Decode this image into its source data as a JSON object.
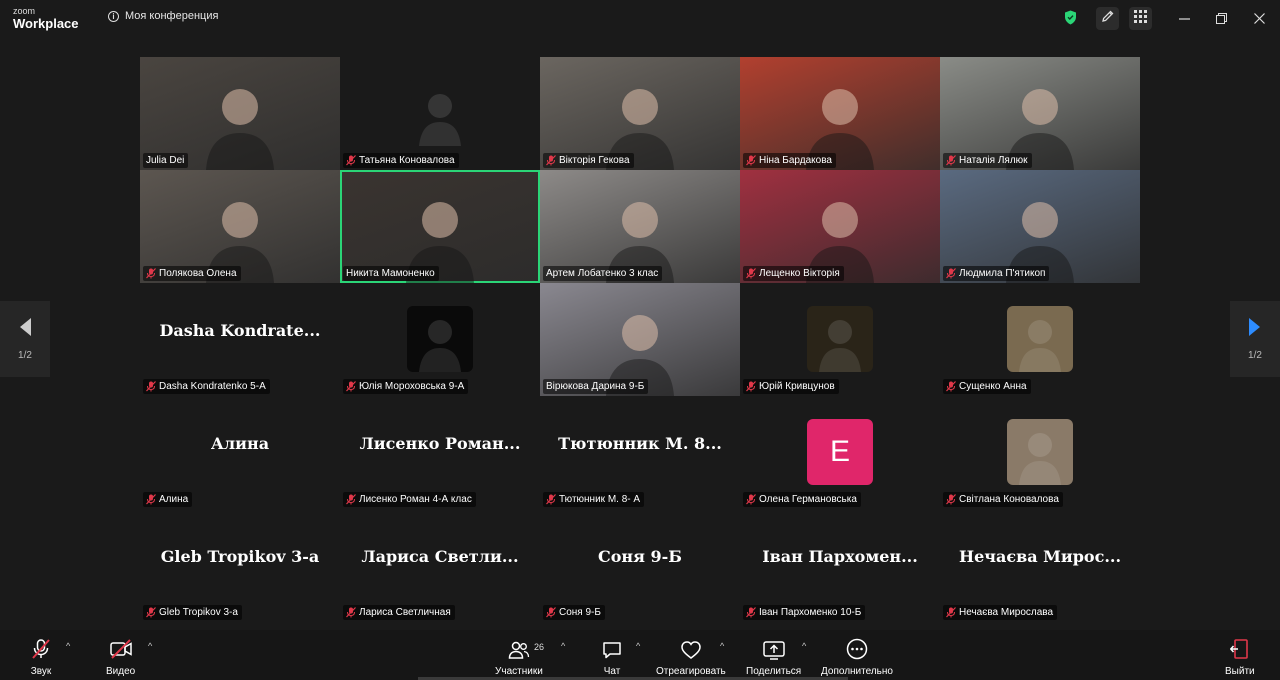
{
  "app": {
    "brand_small": "zoom",
    "brand_big": "Workplace"
  },
  "meeting": {
    "title": "Моя конференция"
  },
  "pager": {
    "left_page": "1/2",
    "right_page": "1/2"
  },
  "participants": [
    {
      "name": "Julia Dei",
      "muted": false,
      "kind": "video",
      "bg": "#4a4540"
    },
    {
      "name": "Татьяна Коновалова",
      "muted": true,
      "kind": "avatar",
      "bg": "#1a1a1a"
    },
    {
      "name": "Вікторія Гекова",
      "muted": true,
      "kind": "video",
      "bg": "#6b6660"
    },
    {
      "name": "Ніна Бардакова",
      "muted": true,
      "kind": "video",
      "bg": "#b2402f"
    },
    {
      "name": "Наталія Лялюк",
      "muted": true,
      "kind": "video",
      "bg": "#8a8c87"
    },
    {
      "name": "Полякова Олена",
      "muted": true,
      "kind": "video",
      "bg": "#5c5650"
    },
    {
      "name": "Никита Мамоненко",
      "muted": false,
      "kind": "video",
      "bg": "#3a3430",
      "active": true
    },
    {
      "name": "Артем Лобатенко 3 клас",
      "muted": false,
      "kind": "video",
      "bg": "#8d8a88"
    },
    {
      "name": "Лещенко Вікторія",
      "muted": true,
      "kind": "video",
      "bg": "#a03040"
    },
    {
      "name": "Людмила П'ятикоп",
      "muted": true,
      "kind": "video",
      "bg": "#5a6a80"
    },
    {
      "name": "Dasha Kondratenko 5-A",
      "display": "Dasha  Kondrate...",
      "muted": true,
      "kind": "text"
    },
    {
      "name": "Юлія Мороховська 9-А",
      "muted": true,
      "kind": "avatar",
      "bg": "#0a0a0a"
    },
    {
      "name": "Вірюкова Дарина 9-Б",
      "muted": false,
      "kind": "video",
      "bg": "#8a8890"
    },
    {
      "name": "Юрій Кривцунов",
      "muted": true,
      "kind": "avatar",
      "bg": "#2a2418"
    },
    {
      "name": "Сущенко Анна",
      "muted": true,
      "kind": "avatar",
      "bg": "#7a6a50"
    },
    {
      "name": "Алина",
      "display": "Алина",
      "muted": true,
      "kind": "text"
    },
    {
      "name": "Лисенко Роман 4-А клас",
      "display": "Лисенко  Роман...",
      "muted": true,
      "kind": "text"
    },
    {
      "name": "Тютюнник М. 8- А",
      "display": "Тютюнник  М.  8...",
      "muted": true,
      "kind": "text"
    },
    {
      "name": "Олена Германовська",
      "muted": true,
      "kind": "letter",
      "letter": "E",
      "bg": "#e0266a"
    },
    {
      "name": "Світлана Коновалова",
      "muted": true,
      "kind": "avatar",
      "bg": "#8a7a68"
    },
    {
      "name": "Gleb Tropikov 3-a",
      "display": "Gleb Tropikov 3-a",
      "muted": true,
      "kind": "text"
    },
    {
      "name": "Лариса Светличная",
      "display": "Лариса  Светли...",
      "muted": true,
      "kind": "text"
    },
    {
      "name": "Соня 9-Б",
      "display": "Соня 9-Б",
      "muted": true,
      "kind": "text"
    },
    {
      "name": "Іван Пархоменко 10-Б",
      "display": "Іван  Пархомен...",
      "muted": true,
      "kind": "text"
    },
    {
      "name": "Нечаєва Мирослава",
      "display": "Нечаєва  Мирос...",
      "muted": true,
      "kind": "text"
    }
  ],
  "toolbar": {
    "audio": "Звук",
    "video": "Видео",
    "participants": "Участники",
    "participants_count": "26",
    "chat": "Чат",
    "react": "Отреагировать",
    "share": "Поделиться",
    "more": "Дополнительно",
    "leave": "Выйти"
  },
  "colors": {
    "accent_green": "#2bd577",
    "mute_red": "#e0384a",
    "share_blue": "#0e72ed",
    "leave_red": "#e0384a",
    "nav_blue": "#2d8cff"
  }
}
